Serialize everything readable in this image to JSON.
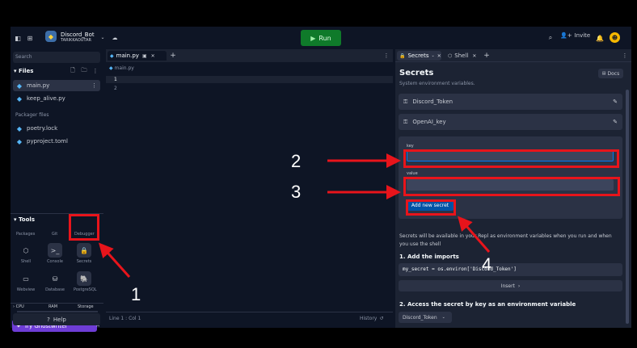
{
  "header": {
    "repl_name": "Discord_Bot",
    "owner": "TARIKKAOUTAR",
    "run_label": "Run",
    "invite_label": "Invite"
  },
  "sidebar": {
    "search_placeholder": "Search",
    "files_label": "Files",
    "files": [
      "main.py",
      "keep_alive.py"
    ],
    "packager_label": "Packager files",
    "packager_files": [
      "poetry.lock",
      "pyproject.toml"
    ],
    "tools_label": "Tools",
    "tools_row_top": [
      "Packages",
      "Git",
      "Debugger"
    ],
    "tools_row1": [
      "Shell",
      "Console",
      "Secrets"
    ],
    "tools_row2": [
      "Webview",
      "Database",
      "PostgreSQL"
    ],
    "usage": [
      "CPU",
      "RAM",
      "Storage"
    ],
    "ghostwriter_label": "Try Ghostwriter",
    "help_label": "Help"
  },
  "editor": {
    "tab_label": "main.py",
    "breadcrumb": "main.py",
    "line_numbers": [
      "1",
      "2"
    ],
    "status": "Line 1 : Col 1",
    "history_label": "History"
  },
  "secrets": {
    "tab_secrets": "Secrets",
    "tab_shell": "Shell",
    "title": "Secrets",
    "subtitle": "System environment variables.",
    "docs_label": "Docs",
    "items": [
      "Discord_Token",
      "OpenAI_key"
    ],
    "key_label": "key",
    "key_value": "",
    "value_label": "value",
    "value_value": "",
    "add_button": "Add new secret",
    "info_line1": "Secrets will be available in your Repl as environment variables when you run and when",
    "info_line2": "you use the shell",
    "step1": "1. Add the imports",
    "code": "my_secret = os.environ['Discord_Token']",
    "insert_label": "Insert",
    "step2": "2. Access the secret by key as an environment variable",
    "secret_select": "Discord_Token"
  },
  "annotations": [
    "1",
    "2",
    "3",
    "4"
  ],
  "colors": {
    "run_green": "#0f7a2a",
    "accent_blue": "#0053a6",
    "annotation_red": "#e8141b"
  }
}
